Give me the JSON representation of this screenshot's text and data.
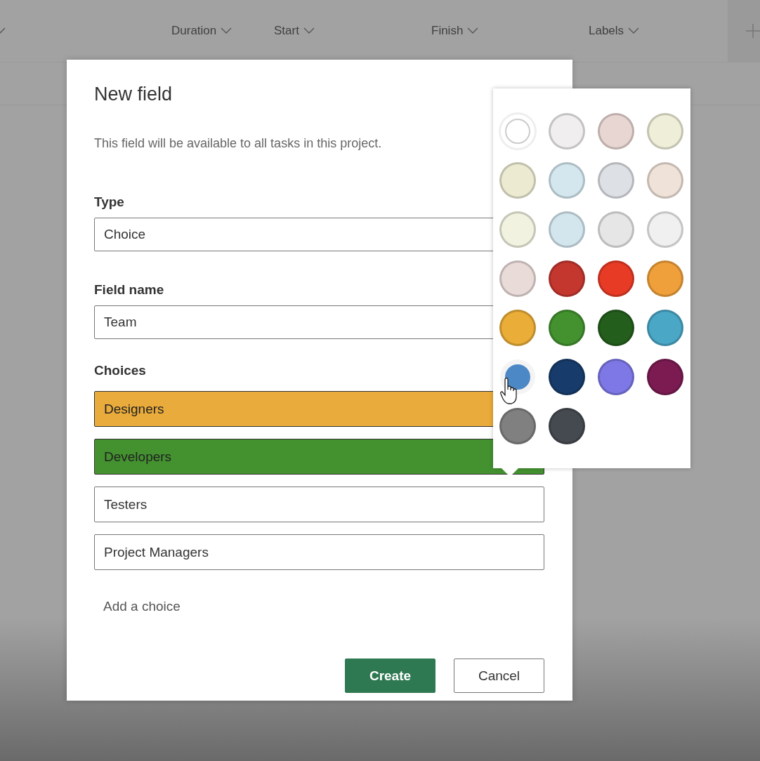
{
  "header": {
    "columns": [
      {
        "label": "Duration"
      },
      {
        "label": "Start"
      },
      {
        "label": "Finish"
      },
      {
        "label": "Labels"
      }
    ]
  },
  "dialog": {
    "title": "New field",
    "description": "This field will be available to all tasks in this project.",
    "type": {
      "label": "Type",
      "value": "Choice"
    },
    "field_name": {
      "label": "Field name",
      "value": "Team"
    },
    "choices": {
      "label": "Choices",
      "items": [
        {
          "value": "Designers",
          "color": "#e9ab3b"
        },
        {
          "value": "Developers",
          "color": "#43922f"
        },
        {
          "value": "Testers"
        },
        {
          "value": "Project Managers"
        }
      ],
      "add_placeholder": "Add a choice"
    },
    "buttons": [
      {
        "label": "Create",
        "kind": "primary"
      },
      {
        "label": "Cancel",
        "kind": "secondary"
      }
    ]
  },
  "color_picker": {
    "swatches": [
      {
        "color": "#ffffff",
        "selected": true,
        "hovered": false
      },
      {
        "color": "#f0eeee",
        "selected": false,
        "hovered": false
      },
      {
        "color": "#e8d6d2",
        "selected": false,
        "hovered": false
      },
      {
        "color": "#efeed8",
        "selected": false,
        "hovered": false
      },
      {
        "color": "#ecebd2",
        "selected": false,
        "hovered": false
      },
      {
        "color": "#d4e7ef",
        "selected": false,
        "hovered": false
      },
      {
        "color": "#dde0e4",
        "selected": false,
        "hovered": false
      },
      {
        "color": "#efe2d8",
        "selected": false,
        "hovered": false
      },
      {
        "color": "#f1f2df",
        "selected": false,
        "hovered": false
      },
      {
        "color": "#d3e6ee",
        "selected": false,
        "hovered": false
      },
      {
        "color": "#e6e6e6",
        "selected": false,
        "hovered": false
      },
      {
        "color": "#f0f0f0",
        "selected": false,
        "hovered": false
      },
      {
        "color": "#e9dbd8",
        "selected": false,
        "hovered": false
      },
      {
        "color": "#c4372f",
        "selected": false,
        "hovered": false
      },
      {
        "color": "#e83b26",
        "selected": false,
        "hovered": false
      },
      {
        "color": "#f0a03a",
        "selected": false,
        "hovered": false
      },
      {
        "color": "#e9ad38",
        "selected": false,
        "hovered": false
      },
      {
        "color": "#43922f",
        "selected": false,
        "hovered": false
      },
      {
        "color": "#245e1d",
        "selected": false,
        "hovered": false
      },
      {
        "color": "#4aa7c6",
        "selected": false,
        "hovered": false
      },
      {
        "color": "#4d88c6",
        "selected": false,
        "hovered": true
      },
      {
        "color": "#173c6b",
        "selected": false,
        "hovered": false
      },
      {
        "color": "#7d78e6",
        "selected": false,
        "hovered": false
      },
      {
        "color": "#7b1b52",
        "selected": false,
        "hovered": false
      },
      {
        "color": "#808080",
        "selected": false,
        "hovered": false
      },
      {
        "color": "#454a50",
        "selected": false,
        "hovered": false
      }
    ]
  }
}
